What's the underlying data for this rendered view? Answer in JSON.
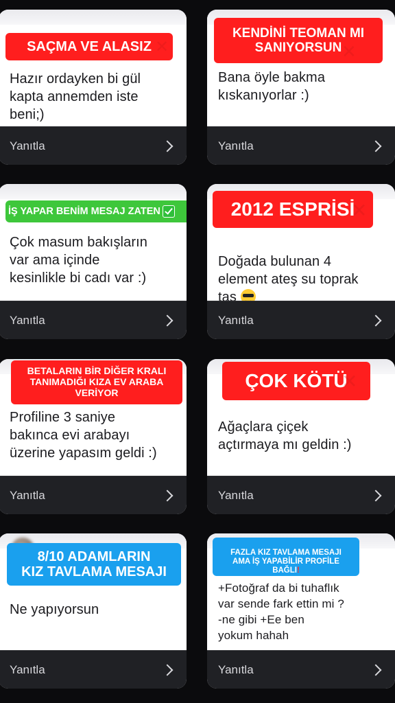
{
  "reply_label": "Yanıtla",
  "cards": [
    {
      "sticker": "SAÇMA VE ALASIZ",
      "message": "Hazır ordayken bi gül\nkapta annemden iste\nbeni;)"
    },
    {
      "sticker": "KENDİNİ TEOMAN MI\nSANIYORSUN",
      "message": "Bana öyle bakma\nkıskanıyorlar :)"
    },
    {
      "sticker": "İŞ YAPAR BENİM MESAJ ZATEN",
      "message": "Çok masum bakışların\nvar ama içinde\nkesinlikle bi cadı var :)"
    },
    {
      "sticker": "2012 ESPRİSİ",
      "message": "Doğada bulunan 4\nelement ateş su toprak\ntaş"
    },
    {
      "sticker": "BETALARIN BİR DİĞER KRALI\nTANIMADIĞI KIZA EV ARABA\nVERİYOR",
      "message": "Profiline 3 saniye\nbakınca evi arabayı\nüzerine yapasım geldi :)"
    },
    {
      "sticker": "ÇOK KÖTÜ",
      "message": "Ağaçlara çiçek\naçtırmaya mı geldin :)"
    },
    {
      "sticker": "8/10 ADAMLARIN\nKIZ TAVLAMA MESAJI",
      "message": "Ne yapıyorsun"
    },
    {
      "sticker": "FAZLA KIZ TAVLAMA MESAJI\nAMA İŞ YAPABİLİR PROFİLE\nBAĞLI",
      "message": "+Fotoğraf da bi tuhaflık\nvar sende fark ettin mi ?\n-ne gibi          +Ee ben\nyokum hahah"
    }
  ],
  "colors": {
    "sticker_red": "#ff1e1e",
    "sticker_green": "#3ec73b",
    "sticker_blue": "#1aa0ee",
    "footer_bg": "#202125",
    "page_bg": "#0b0b0d"
  },
  "icons": {
    "chevron": "chevron-right-icon",
    "check": "check-box-icon",
    "emoji": "sunglasses-emoji-icon",
    "exclamation": "red-exclamation-icon",
    "x": "red-x-icon"
  }
}
